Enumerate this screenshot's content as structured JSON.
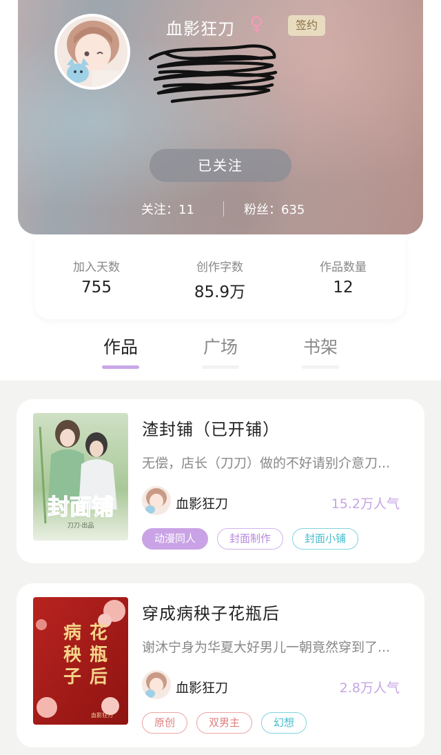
{
  "profile": {
    "username": "血影狂刀",
    "gender_symbol": "♀",
    "badge": "签约",
    "follow_button": "已关注",
    "following_text": "关注：11",
    "fans_text": "粉丝：635"
  },
  "stats": [
    {
      "label": "加入天数",
      "value": "755"
    },
    {
      "label": "创作字数",
      "value": "85.9万"
    },
    {
      "label": "作品数量",
      "value": "12"
    }
  ],
  "tabs": [
    {
      "label": "作品",
      "active": true
    },
    {
      "label": "广场",
      "active": false
    },
    {
      "label": "书架",
      "active": false
    }
  ],
  "books": [
    {
      "title": "渣封铺（已开铺）",
      "description": "无偿，店长（刀刀）做的不好请别介意刀...",
      "author": "血影狂刀",
      "popularity": "15.2万人气",
      "cover_text": "封面铺",
      "cover_subtext": "刀刀·出品",
      "tags": [
        {
          "label": "动漫同人",
          "style": "filled"
        },
        {
          "label": "封面制作",
          "style": "purple"
        },
        {
          "label": "封面小铺",
          "style": "cyan"
        }
      ]
    },
    {
      "title": "穿成病秧子花瓶后",
      "description": "谢沐宁身为华夏大好男儿一朝竟然穿到了...",
      "author": "血影狂刀",
      "popularity": "2.8万人气",
      "cover_text": "病秧子花瓶后",
      "cover_subtext": "血影狂刀",
      "tags": [
        {
          "label": "原创",
          "style": "red"
        },
        {
          "label": "双男主",
          "style": "red"
        },
        {
          "label": "幻想",
          "style": "cyan"
        }
      ]
    }
  ],
  "colors": {
    "accent_purple": "#c9a6e8",
    "popularity": "#c6a4e4",
    "badge_bg": "#e8dcc0"
  }
}
